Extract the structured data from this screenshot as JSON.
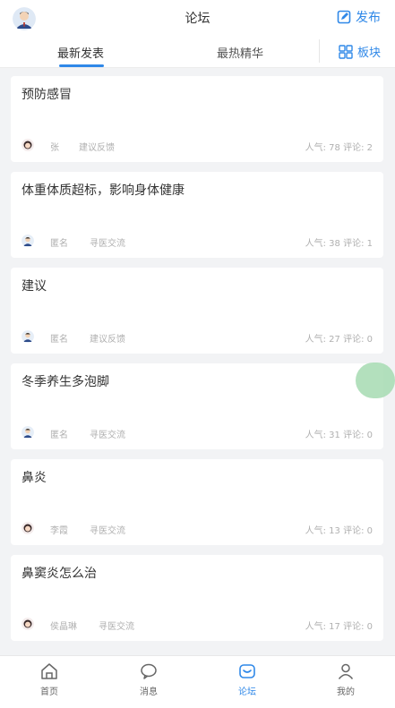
{
  "header": {
    "title": "论坛",
    "publish_label": "发布"
  },
  "tabs": {
    "latest": "最新发表",
    "hot": "最热精华",
    "board_label": "板块"
  },
  "posts": [
    {
      "title": "预防感冒",
      "author": "张",
      "category": "建议反馈",
      "stats": "人气: 78  评论: 2",
      "avatar": "female"
    },
    {
      "title": "体重体质超标，影响身体健康",
      "author": "匿名",
      "category": "寻医交流",
      "stats": "人气: 38  评论: 1",
      "avatar": "male"
    },
    {
      "title": "建议",
      "author": "匿名",
      "category": "建议反馈",
      "stats": "人气: 27  评论: 0",
      "avatar": "male"
    },
    {
      "title": "冬季养生多泡脚",
      "author": "匿名",
      "category": "寻医交流",
      "stats": "人气: 31  评论: 0",
      "avatar": "male"
    },
    {
      "title": "鼻炎",
      "author": "李霞",
      "category": "寻医交流",
      "stats": "人气: 13  评论: 0",
      "avatar": "female"
    },
    {
      "title": "鼻窦炎怎么治",
      "author": "侯晶琳",
      "category": "寻医交流",
      "stats": "人气: 17  评论: 0",
      "avatar": "female"
    }
  ],
  "nav": {
    "home": "首页",
    "messages": "消息",
    "forum": "论坛",
    "mine": "我的"
  },
  "colors": {
    "accent": "#2f88e8",
    "fab": "#a6dbb1"
  }
}
